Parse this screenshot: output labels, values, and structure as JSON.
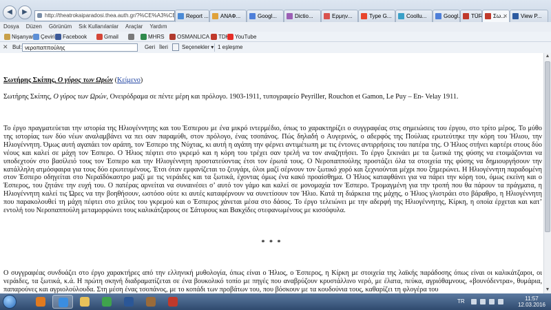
{
  "browser": {
    "url": "http://theatrokaiparadosi.thea.auth.gr/?%CE%A3%CE%",
    "tabs": [
      {
        "label": "Report ...",
        "color": "#4b8bd6"
      },
      {
        "label": "ΑΝΑΦ...",
        "color": "#e0a23a"
      },
      {
        "label": "Googl...",
        "color": "#4e7fd9"
      },
      {
        "label": "Dictio...",
        "color": "#9c5fb5"
      },
      {
        "label": "Ερμην...",
        "color": "#d9534f"
      },
      {
        "label": "Type G...",
        "color": "#e8452c"
      },
      {
        "label": "Coollu...",
        "color": "#3aa0c8"
      },
      {
        "label": "Googl...",
        "color": "#4e7fd9"
      },
      {
        "label": "TÜRK ...",
        "color": "#c0392b"
      },
      {
        "label": "Σω...",
        "color": "#c0392b"
      },
      {
        "label": "View P...",
        "color": "#2c5aa0"
      }
    ],
    "menu": [
      "Dosya",
      "Düzen",
      "Görünüm",
      "Sık Kullanılanlar",
      "Araçlar",
      "Yardım"
    ],
    "favorites": [
      {
        "label": "Nişanyan",
        "color": "#c8a04a"
      },
      {
        "label": "Çeviri",
        "color": "#5d8fd6"
      },
      {
        "label": "Facebook",
        "color": "#3b5998"
      },
      {
        "label": "Gmail",
        "color": "#d44638"
      },
      {
        "label": "",
        "color": "#7a7a7a"
      },
      {
        "label": "MHRS",
        "color": "#2f8a4c"
      },
      {
        "label": "OSMANLICA",
        "color": "#b03a2e"
      },
      {
        "label": "TDK",
        "color": "#c0392b"
      },
      {
        "label": "YouTube",
        "color": "#e52d27"
      }
    ],
    "find": {
      "label": "Bul:",
      "value": "νεροπαππούλης",
      "prev": "Geri",
      "next": "İleri",
      "options": "Seçenekler",
      "matches": "1 eşleşme"
    }
  },
  "document": {
    "title_author": "Σωτήρης Σκίπης, ",
    "title_work": "Ο γύρος των Ωρών",
    "title_link_open": " (",
    "title_link": "Κείμενο",
    "title_link_close": ")",
    "biblio_author": "Σωτήρης Σκίπης, ",
    "biblio_work": "Ο γύρος των Ωρών",
    "biblio_rest": ", Ονειρόδραμα σε πέντε μέρη και πρόλογο. 1903-1911, τυπογραφείο Peyriller, Rouchon et Gamon, Le Puy – En- Velay 1911.",
    "paragraph1": "Το έργο πραγματεύεται την ιστορία της Ηλιογέννητης και του Έσπερου με ένα μικρό ιντερμέδιο, όπως το χαρακτηρίζει ο συγγραφέας στις σημειώσεις του έργου, στο τρίτο μέρος. Το μύθο της ιστορίας των δύο νέων αναλαμβάνει να πει σαν παραμύθι, στον πρόλογο, ένας τσοπάνος. Πώς δηλαδή ο Αυγερινός, ο αδερφός της Πούλιας ερωτεύτηκε την κόρη του Ήλιου, την Ηλιογέννητη. Όμως αυτή αγαπάει τον αράπη, τον Έσπερο της Νύχτας, κι αυτή η αγάπη την φέρνει αντιμέτωπη με τις έντονες αντιρρήσεις του πατέρα της. Ο Ήλιος στήνει καρτέρι στους δύο νέους και καλεί σε μάχη τον Έσπερο. Ο Ήλιος πέφτει στο γκρεμό και η κόρη του τρέχει σαν τρελή να τον αναζητήσει. Το έργο ξεκινάει με τα ξωτικά της φύσης να ετοιμάζονται να υποδεχτούν στο βασίλειό τους τον Έσπερο και την Ηλιογέννητη προστατεύοντας έτσι τον έρωτά τους. Ο Νεροπαππούλης προστάζει όλα τα στοιχεία της φύσης να δημιουργήσουν την κατάλληλη ατμόσφαιρα για τους δύο ερωτευμένους. Έτσι όταν εμφανίζεται το ζευγάρι, όλοι μαζί σέρνουν τον ξωτικό χορό και ξεχνιούνται μέχρι που ξημερώνει. Η Ηλιογέννητη παραδομένη στον Έσπερο οδηγείται στο Νεραϊδόκαστρο μαζί με τις νεράιδες και τα ξωτικά, έχοντας όμως ένα κακό προαίσθημα. Ο Ήλιος καταφθάνει για να πάρει την κόρη του, όμως εκείνη και ο Έσπερος, του ζητάνε την ευχή του. Ο πατέρας αρνείται να συναινέσει σ’ αυτό τον γάμο και καλεί σε μονομαχία τον Έσπερο. Τρομαγμένη για την τροπή που θα πάρουν τα πράγματα, η Ηλιογέννητη καλεί τις Ώρες να την βοηθήσουν, ωστόσο ούτε κι αυτές καταφέρνουν να συνετίσουν τον Ήλιο. Κατά τη διάρκεια της μάχης, ο Ήλιος γλιστράει στο βάραθρο, η Ηλιογέννητη που παρακολουθεί τη μάχη πέφτει στο χείλος του γκρεμού και ο Έσπερος χάνεται μέσα στο δάσος. Το έργο τελειώνει με την αδερφή της Ηλιογέννητης, Κίρκη, η οποία έρχεται και κατ’ εντολή του Νεροπαππούλη μεταμορφώνει τους καλικάτζαρους σε Σάτυρους και Βακχίδες στεφανωμένους με κισσόφυλα.",
    "separator": "* * *",
    "paragraph2": "Ο συγγραφέας συνδυάζει στο έργο χαρακτήρες από την ελληνική μυθολογία, όπως είναι ο Ήλιος, ο Έσπερος, η Κίρκη με στοιχεία της λαϊκής παράδοσης όπως είναι οι καλικάτζαροι, οι νεράιδες, τα ξωτικά, κ.ά. Η πρώτη σκηνή διαδραματίζεται σε ένα βουκολικό τοπίο με πηγές που αναβρύζουν κρυστάλλινο νερό, με έλατα, πεύκα, αγριόθαμνους, «βουνόδεντρα», θυμάρια, παπαρούνες και αγριολούλουδα. Στη μέση ένας τσοπάνος, με το κοπάδι των προβάτων του, που βόσκουν με τα κουδούνια τους, καθαρίζει τη φλογέρα του"
  },
  "taskbar": {
    "apps": [
      {
        "name": "media-player-icon",
        "color": "#e07a1f"
      },
      {
        "name": "internet-explorer-icon",
        "color": "#3a8de0"
      },
      {
        "name": "file-explorer-icon",
        "color": "#e8c25a"
      },
      {
        "name": "chrome-icon",
        "color": "#3fa34d"
      },
      {
        "name": "word-icon",
        "color": "#2b5797"
      },
      {
        "name": "photos-icon",
        "color": "#9a6b3a"
      },
      {
        "name": "acrobat-icon",
        "color": "#c0392b"
      }
    ],
    "language": "TR",
    "time": "11:57",
    "date": "12.03.2016"
  }
}
